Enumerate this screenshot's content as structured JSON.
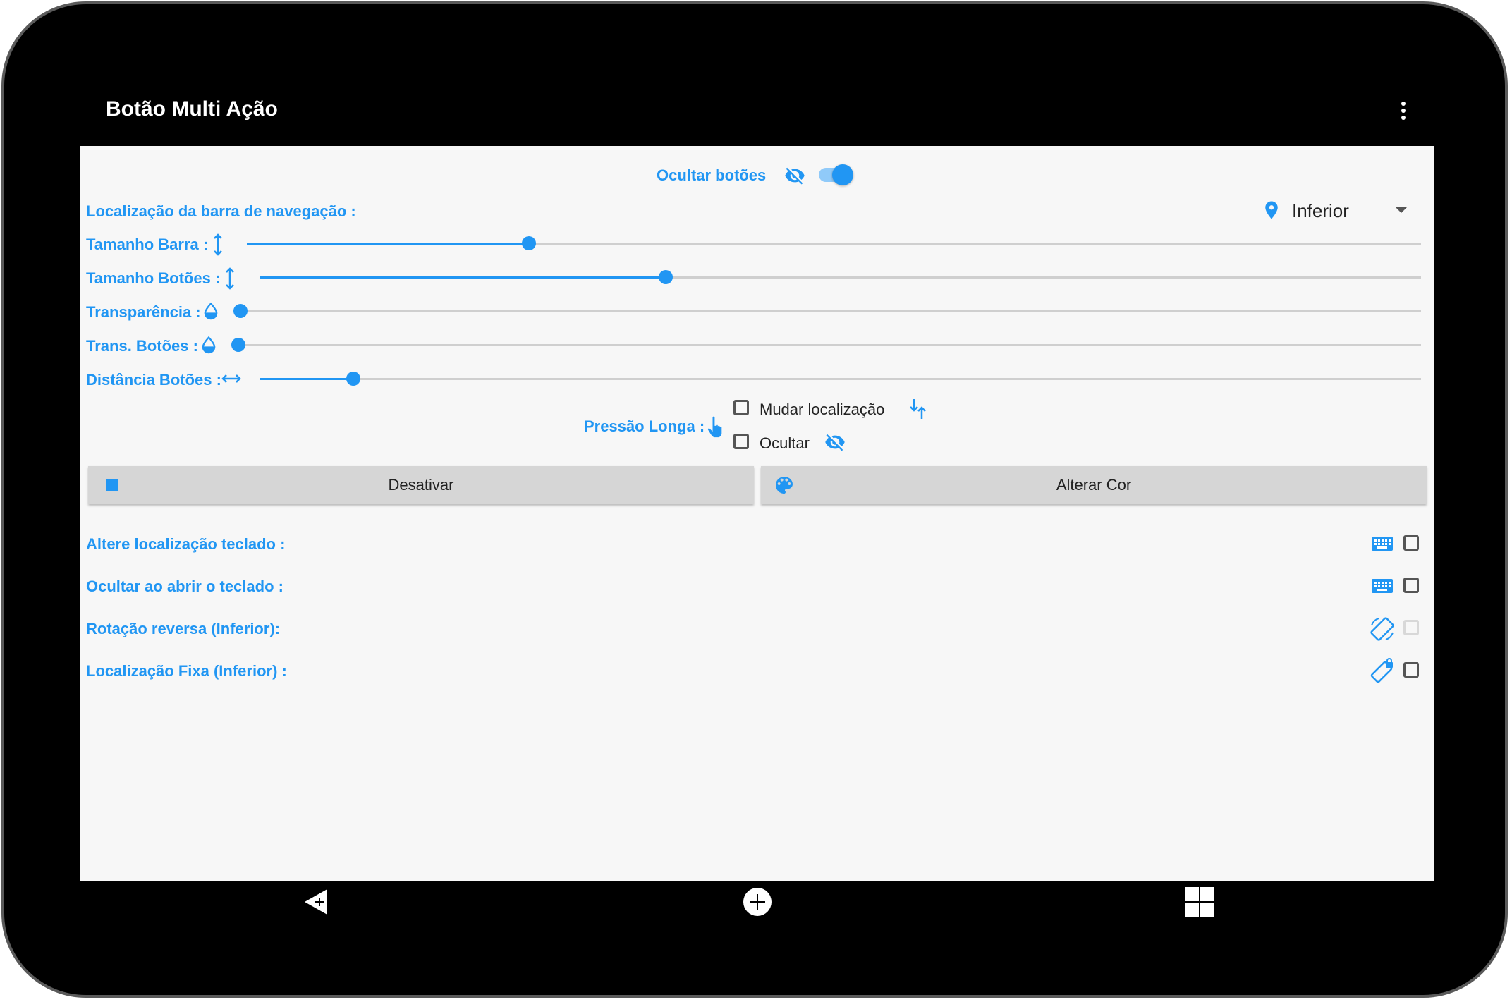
{
  "app": {
    "title": "Botão Multi Ação"
  },
  "header": {
    "hide_buttons_label": "Ocultar botões",
    "hide_buttons_on": true
  },
  "navbar_location": {
    "label": "Localização da barra de navegação :",
    "selected": "Inferior"
  },
  "sliders": [
    {
      "label": "Tamanho Barra :",
      "value": 0.24,
      "icon": "vertical-resize-icon"
    },
    {
      "label": "Tamanho Botões :",
      "value": 0.35,
      "icon": "vertical-resize-icon"
    },
    {
      "label": "Transparência :",
      "value": 0.0,
      "icon": "opacity-drop-icon"
    },
    {
      "label": "Trans. Botões :",
      "value": 0.0,
      "icon": "opacity-drop-icon"
    },
    {
      "label": "Distância Botões :",
      "value": 0.08,
      "icon": "horizontal-resize-icon"
    }
  ],
  "long_press": {
    "label": "Pressão Longa :",
    "options": [
      {
        "label": "Mudar localização",
        "checked": false
      },
      {
        "label": "Ocultar",
        "checked": false
      }
    ]
  },
  "buttons": {
    "disable": "Desativar",
    "change_color": "Alterar Cor"
  },
  "options": [
    {
      "label": "Altere localização teclado :",
      "checked": false,
      "enabled": true,
      "icon": "keyboard-icon"
    },
    {
      "label": "Ocultar ao abrir o teclado :",
      "checked": false,
      "enabled": true,
      "icon": "keyboard-icon"
    },
    {
      "label": "Rotação reversa (Inferior):",
      "checked": false,
      "enabled": false,
      "icon": "screen-rotation-icon"
    },
    {
      "label": "Localização Fixa (Inferior) :",
      "checked": false,
      "enabled": true,
      "icon": "screen-lock-rotation-icon"
    }
  ],
  "colors": {
    "accent": "#2196f3",
    "accent_light": "#90caf9",
    "background": "#f7f7f7",
    "button": "#d6d6d6"
  }
}
